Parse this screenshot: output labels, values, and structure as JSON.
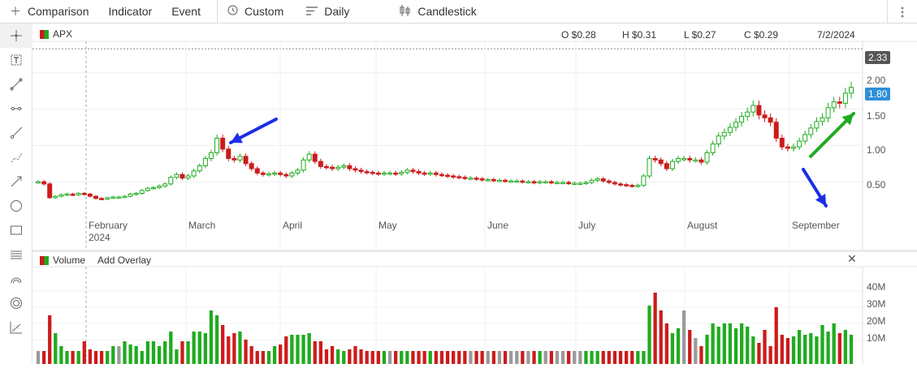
{
  "toolbar": {
    "comparison": "Comparison",
    "indicator": "Indicator",
    "event": "Event",
    "custom": "Custom",
    "daily": "Daily",
    "candlestick": "Candlestick"
  },
  "symbol": "APX",
  "ohlc": {
    "open": "O $0.28",
    "high": "H $0.31",
    "low": "L $0.27",
    "close": "C $0.29",
    "date": "7/2/2024"
  },
  "price_axis": {
    "labels": [
      "2.00",
      "1.50",
      "1.00",
      "0.50"
    ],
    "high_badge": "2.33",
    "last_badge": "1.80"
  },
  "volume_panel": {
    "title": "Volume",
    "add_overlay": "Add Overlay",
    "labels": [
      "40M",
      "30M",
      "20M",
      "10M"
    ]
  },
  "months": [
    "February",
    "March",
    "April",
    "May",
    "June",
    "July",
    "August",
    "September"
  ],
  "year_label": "2024",
  "colors": {
    "up": "#1fab1f",
    "down": "#cc1b1b",
    "neutral": "#9a9a9a",
    "last_badge": "#2e8fd8",
    "high_badge": "#555555",
    "arrow_blue": "#1a2ee8",
    "arrow_green": "#1fab1f"
  },
  "chart_data": {
    "type": "candlestick",
    "ylim": [
      0,
      2.4
    ],
    "volume_ylim": [
      0,
      45000000
    ],
    "reference_high": 2.33,
    "last_price": 1.8,
    "closes": [
      0.5,
      0.47,
      0.28,
      0.3,
      0.32,
      0.33,
      0.32,
      0.34,
      0.33,
      0.3,
      0.27,
      0.26,
      0.28,
      0.29,
      0.29,
      0.3,
      0.33,
      0.34,
      0.38,
      0.41,
      0.42,
      0.44,
      0.47,
      0.56,
      0.6,
      0.55,
      0.58,
      0.65,
      0.72,
      0.82,
      0.9,
      1.1,
      0.95,
      0.82,
      0.8,
      0.85,
      0.75,
      0.68,
      0.62,
      0.6,
      0.61,
      0.62,
      0.6,
      0.58,
      0.62,
      0.66,
      0.8,
      0.88,
      0.78,
      0.71,
      0.7,
      0.68,
      0.7,
      0.72,
      0.68,
      0.66,
      0.64,
      0.63,
      0.62,
      0.61,
      0.62,
      0.62,
      0.61,
      0.63,
      0.66,
      0.64,
      0.62,
      0.61,
      0.62,
      0.6,
      0.59,
      0.58,
      0.57,
      0.56,
      0.55,
      0.55,
      0.54,
      0.53,
      0.53,
      0.52,
      0.52,
      0.51,
      0.51,
      0.51,
      0.5,
      0.5,
      0.49,
      0.5,
      0.5,
      0.49,
      0.49,
      0.49,
      0.48,
      0.48,
      0.48,
      0.49,
      0.52,
      0.54,
      0.51,
      0.49,
      0.47,
      0.46,
      0.45,
      0.44,
      0.45,
      0.58,
      0.82,
      0.8,
      0.75,
      0.68,
      0.78,
      0.82,
      0.82,
      0.8,
      0.8,
      0.77,
      0.9,
      1.02,
      1.13,
      1.18,
      1.25,
      1.32,
      1.4,
      1.46,
      1.55,
      1.42,
      1.38,
      1.32,
      1.1,
      0.98,
      0.96,
      0.98,
      1.06,
      1.15,
      1.24,
      1.33,
      1.38,
      1.52,
      1.6,
      1.58,
      1.72,
      1.8
    ],
    "volumes": [
      3,
      3,
      25,
      14,
      6,
      3,
      3,
      3,
      9,
      4,
      3,
      3,
      3,
      6,
      6,
      9,
      7,
      6,
      3,
      9,
      9,
      6,
      9,
      15,
      4,
      9,
      9,
      15,
      15,
      14,
      28,
      25,
      19,
      12,
      14,
      15,
      10,
      6,
      3,
      3,
      3,
      6,
      7,
      12,
      13,
      13,
      13,
      14,
      9,
      9,
      4,
      6,
      4,
      3,
      4,
      6,
      4,
      3,
      3,
      3,
      3,
      3,
      3,
      3,
      3,
      3,
      3,
      3,
      3,
      3,
      3,
      3,
      3,
      3,
      3,
      3,
      3,
      3,
      3,
      3,
      3,
      3,
      3,
      3,
      3,
      3,
      3,
      3,
      3,
      3,
      3,
      3,
      3,
      3,
      3,
      3,
      3,
      3,
      3,
      3,
      3,
      3,
      3,
      3,
      3,
      3,
      31,
      39,
      28,
      20,
      14,
      17,
      28,
      16,
      11,
      6,
      13,
      20,
      18,
      20,
      20,
      17,
      20,
      18,
      12,
      8,
      16,
      6,
      30,
      13,
      11,
      12,
      16,
      13,
      14,
      12,
      19,
      15,
      20,
      14,
      16,
      13
    ]
  }
}
